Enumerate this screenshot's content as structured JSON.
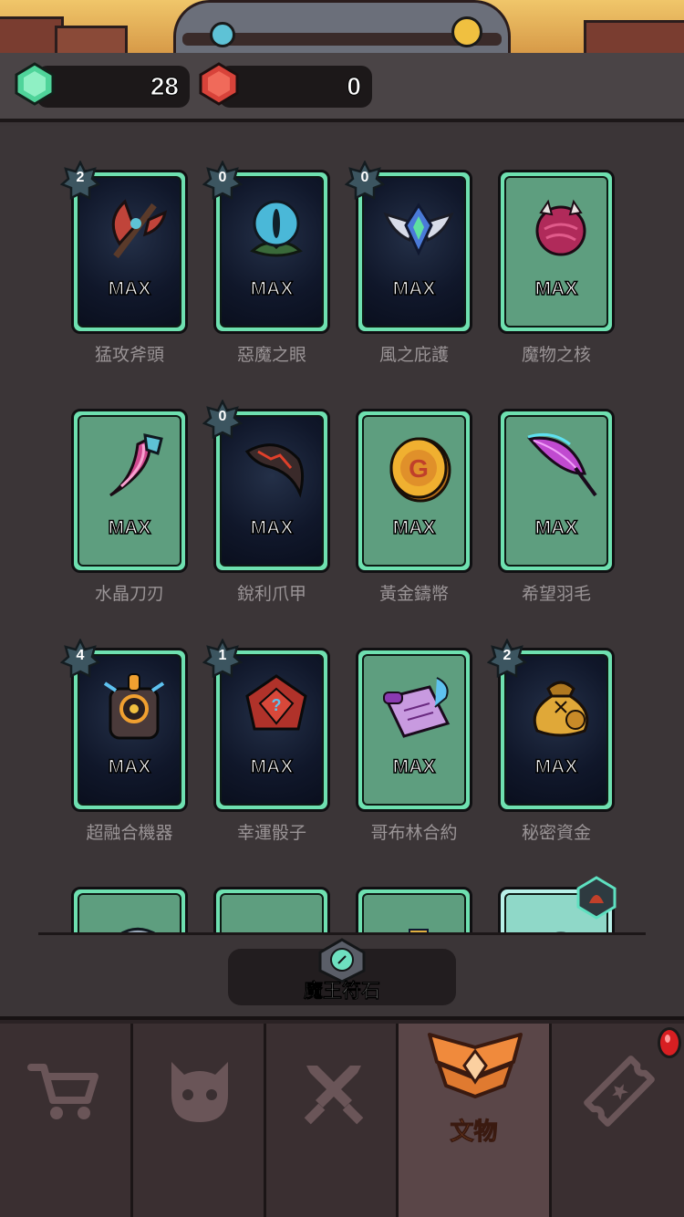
{
  "currency": {
    "green_gem": {
      "icon": "green-gem-icon",
      "value": "28"
    },
    "red_gem": {
      "icon": "red-gem-icon",
      "value": "0"
    }
  },
  "relics": [
    {
      "name": "猛攻斧頭",
      "status": "MAX",
      "stars": "2",
      "style": "dark",
      "icon": "axe-icon"
    },
    {
      "name": "惡魔之眼",
      "status": "MAX",
      "stars": "0",
      "style": "dark",
      "icon": "demon-eye-icon"
    },
    {
      "name": "風之庇護",
      "status": "MAX",
      "stars": "0",
      "style": "dark",
      "icon": "wing-emblem-icon"
    },
    {
      "name": "魔物之核",
      "status": "MAX",
      "stars": "",
      "style": "green",
      "icon": "monster-core-icon"
    },
    {
      "name": "水晶刀刃",
      "status": "MAX",
      "stars": "",
      "style": "green",
      "icon": "crystal-blade-icon"
    },
    {
      "name": "銳利爪甲",
      "status": "MAX",
      "stars": "0",
      "style": "dark",
      "icon": "claw-icon"
    },
    {
      "name": "黃金鑄幣",
      "status": "MAX",
      "stars": "",
      "style": "green",
      "icon": "gold-coin-icon"
    },
    {
      "name": "希望羽毛",
      "status": "MAX",
      "stars": "",
      "style": "green",
      "icon": "feather-icon"
    },
    {
      "name": "超融合機器",
      "status": "MAX",
      "stars": "4",
      "style": "dark",
      "icon": "fusion-machine-icon"
    },
    {
      "name": "幸運骰子",
      "status": "MAX",
      "stars": "1",
      "style": "dark",
      "icon": "dice-icon"
    },
    {
      "name": "哥布林合約",
      "status": "MAX",
      "stars": "",
      "style": "green",
      "icon": "contract-icon"
    },
    {
      "name": "秘密資金",
      "status": "MAX",
      "stars": "2",
      "style": "dark",
      "icon": "money-bag-icon"
    }
  ],
  "rune_button": {
    "label": "魔王符石",
    "icon": "rune-stone-icon"
  },
  "tabs": [
    {
      "id": "shop",
      "icon": "cart-icon",
      "label": ""
    },
    {
      "id": "monster",
      "icon": "monster-face-icon",
      "label": ""
    },
    {
      "id": "battle",
      "icon": "crossed-swords-icon",
      "label": ""
    },
    {
      "id": "relics",
      "icon": "rank-emblem-icon",
      "label": "文物",
      "active": true
    },
    {
      "id": "pass",
      "icon": "ticket-icon",
      "label": "",
      "notification": true
    }
  ],
  "colors": {
    "card_border": "#6ee0b0",
    "tab_active_label": "#f08a3c",
    "notification": "#d81f22"
  }
}
